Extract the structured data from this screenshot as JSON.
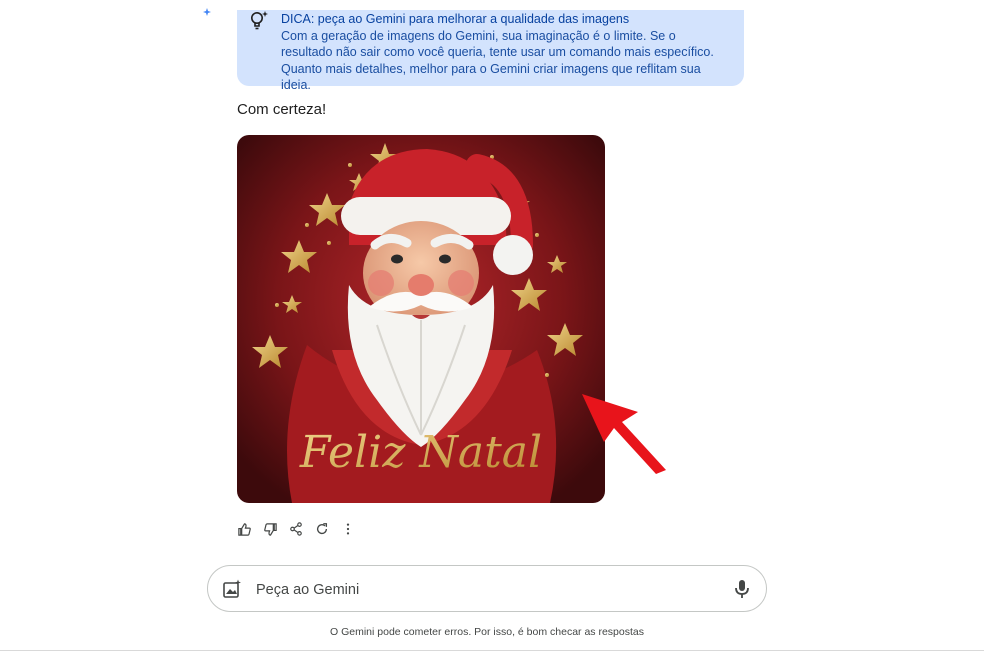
{
  "tip": {
    "icon": "lightbulb-sparkle-icon",
    "title": "DICA: peça ao Gemini para melhorar a qualidade das imagens",
    "body": "Com a geração de imagens do Gemini, sua imaginação é o limite. Se o resultado não sair como você queria, tente usar um comando mais específico. Quanto mais detalhes, melhor para o Gemini criar imagens que reflitam sua ideia."
  },
  "response": {
    "text": "Com certeza!",
    "image": {
      "caption": "Feliz Natal",
      "description_icon": "santa-claus-image"
    },
    "actions": [
      {
        "name": "thumbs-up-icon"
      },
      {
        "name": "thumbs-down-icon"
      },
      {
        "name": "share-icon"
      },
      {
        "name": "regenerate-icon"
      },
      {
        "name": "more-options-icon"
      }
    ]
  },
  "input": {
    "placeholder": "Peça ao Gemini",
    "upload_icon": "add-image-icon",
    "mic_icon": "microphone-icon"
  },
  "footer": {
    "disclaimer": "O Gemini pode cometer erros. Por isso, é bom checar as respostas"
  },
  "colors": {
    "tip_background": "#d3e3fd",
    "image_background": "#7a1518",
    "arrow": "#e8141b",
    "gold": "#d9b25a"
  }
}
